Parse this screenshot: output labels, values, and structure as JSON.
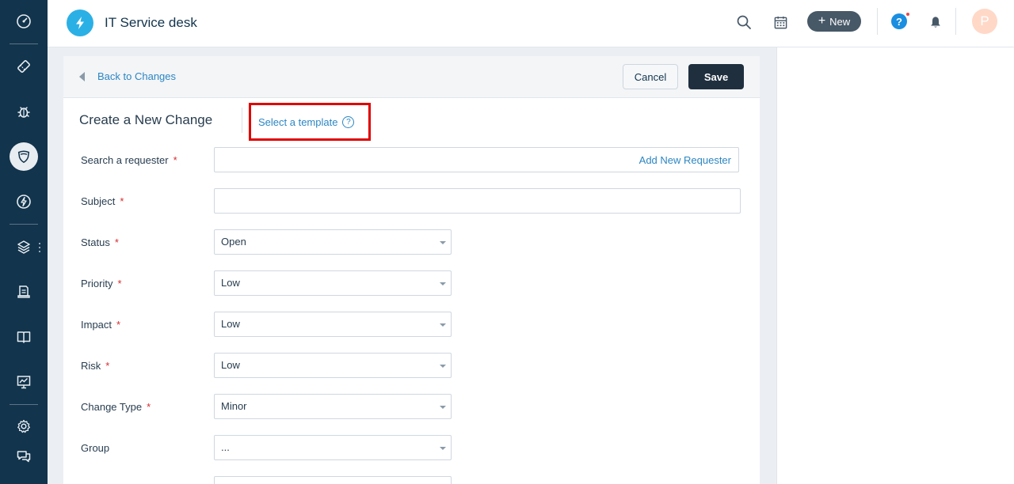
{
  "app": {
    "title": "IT Service desk"
  },
  "topbar": {
    "new_label": "New",
    "avatar_initial": "P"
  },
  "header": {
    "back_label": "Back to Changes",
    "cancel_label": "Cancel",
    "save_label": "Save"
  },
  "form": {
    "title": "Create a New Change",
    "template_link": "Select a template",
    "template_help": "?",
    "required_mark": "*",
    "requester": {
      "label": "Search a requester",
      "value": "",
      "add_label": "Add New Requester"
    },
    "subject": {
      "label": "Subject",
      "value": ""
    },
    "status": {
      "label": "Status",
      "value": "Open"
    },
    "priority": {
      "label": "Priority",
      "value": "Low"
    },
    "impact": {
      "label": "Impact",
      "value": "Low"
    },
    "risk": {
      "label": "Risk",
      "value": "Low"
    },
    "change_type": {
      "label": "Change Type",
      "value": "Minor"
    },
    "group": {
      "label": "Group",
      "value": "..."
    }
  },
  "colors": {
    "nav_bg": "#12344d",
    "accent": "#2c86c3",
    "save_bg": "#1f2f3e",
    "highlight": "#e00000"
  }
}
